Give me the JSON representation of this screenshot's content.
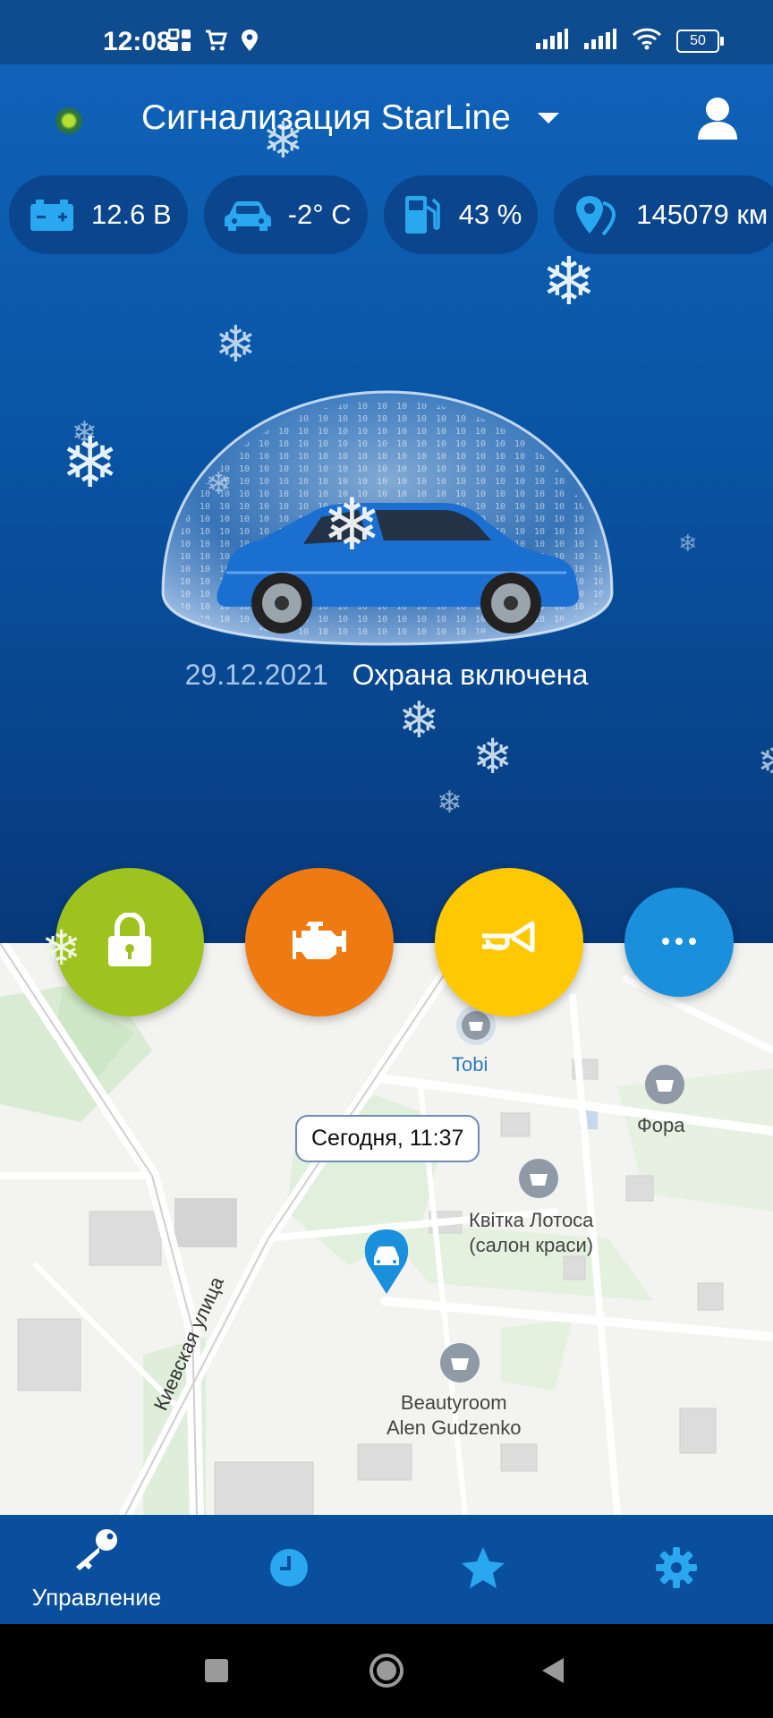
{
  "status_bar": {
    "time": "12:08",
    "battery": "50",
    "icons": [
      "grid-icon",
      "cart-icon",
      "location-icon",
      "signal-icon",
      "signal-icon",
      "wifi-icon",
      "battery-icon"
    ]
  },
  "header": {
    "title": "Сигнализация StarLine",
    "status_dot_color": "#b7e030"
  },
  "metrics": [
    {
      "icon": "battery-icon",
      "value": "12.6 В"
    },
    {
      "icon": "car-icon",
      "value": "-2° C"
    },
    {
      "icon": "fuel-icon",
      "value": "43 %"
    },
    {
      "icon": "mileage-icon",
      "value": "145079 км"
    }
  ],
  "security": {
    "date": "29.12.2021",
    "status": "Охрана включена"
  },
  "actions": [
    {
      "name": "lock",
      "icon": "lock-icon",
      "color": "#9fc31e"
    },
    {
      "name": "engine",
      "icon": "engine-icon",
      "color": "#ef7a12"
    },
    {
      "name": "horn",
      "icon": "horn-icon",
      "color": "#ffc800"
    },
    {
      "name": "more",
      "icon": "more-icon",
      "color": "#1a8fdc"
    }
  ],
  "map": {
    "pin_label": "Сегодня, 11:37",
    "street": "Киевская улица",
    "pois": [
      {
        "label": "Tobi",
        "color": "#2c7bbf"
      },
      {
        "label": "Фора"
      },
      {
        "label": "Квітка Лотоса (салон краси)",
        "line1": "Квітка Лотоса",
        "line2": "(салон краси)"
      },
      {
        "label": "Beautyroom Alen Gudzenko",
        "line1": "Beautyroom",
        "line2": "Alen Gudzenko"
      }
    ]
  },
  "bottom_nav": [
    {
      "label": "Управление",
      "icon": "key-icon",
      "active": true
    },
    {
      "label": "",
      "icon": "history-icon",
      "active": false
    },
    {
      "label": "",
      "icon": "star-icon",
      "active": false
    },
    {
      "label": "",
      "icon": "settings-icon",
      "active": false
    }
  ],
  "colors": {
    "header_blue": "#0f62b8",
    "nav_blue": "#0a4f9e",
    "accent_blue": "#1aa3e8"
  }
}
